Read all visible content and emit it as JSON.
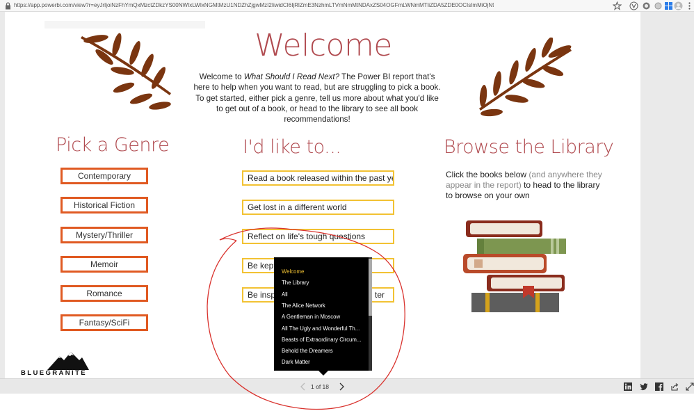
{
  "browser": {
    "url": "https://app.powerbi.com/view?r=eyJrIjoiNzFhYmQxMzctZDkzYS00NWIxLWIxNGMtMzU1NDZhZjgwMzI2IiwidCI6IjRlZmE3NzhmLTVmNmMtNDAxZS04OGFmLWNmMTliZDA5ZDE0OCIsImMiOjN9"
  },
  "welcome": {
    "title": "Welcome",
    "intro_prefix": "Welcome to ",
    "intro_italic": "What Should I Read Next?",
    "intro_suffix": " The Power BI report that's here to help when you want to read, but are struggling to pick a book. To get started, either pick a genre, tell us more about what you'd like to get out of a book, or head to the library to see all book recommendations!"
  },
  "genre": {
    "title": "Pick a Genre",
    "buttons": [
      "Contemporary",
      "Historical Fiction",
      "Mystery/Thriller",
      "Memoir",
      "Romance",
      "Fantasy/SciFi"
    ]
  },
  "like": {
    "title": "I'd like to...",
    "buttons": [
      "Read a book released within the past year",
      "Get lost in a different world",
      "Reflect on life's tough questions",
      "Be kept",
      "Be inspi"
    ],
    "partial_right": "ter"
  },
  "library": {
    "title": "Browse the Library",
    "desc_a": "Click the books below ",
    "desc_muted": "(and anywhere they appear in the report)",
    "desc_b": " to head to the library to browse on your own"
  },
  "popup": {
    "items": [
      "Welcome",
      "The Library",
      "All",
      "The Alice Network",
      "A Gentleman in Moscow",
      "All The Ugly and Wonderful Th...",
      "Beasts of Extraordinary Circum...",
      "Behold the Dreamers",
      "Dark Matter"
    ],
    "active_index": 0
  },
  "pager": {
    "label": "1 of 18"
  },
  "brand": {
    "name": "BLUEGRANITE"
  },
  "colors": {
    "accent_red": "#b04a4f",
    "genre_border": "#e05a22",
    "like_border": "#f2c233",
    "leaf_brown": "#7a3510",
    "annotation": "#d9332e"
  }
}
